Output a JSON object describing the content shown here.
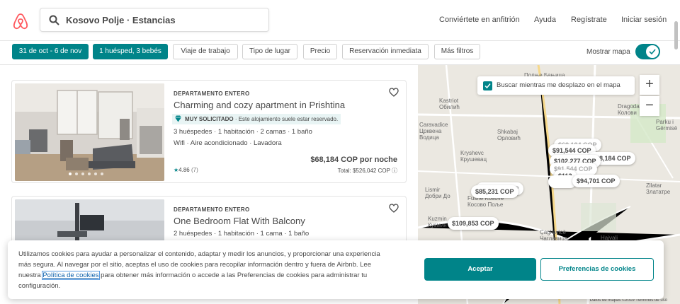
{
  "search": {
    "query": "Kosovo Polje · Estancias"
  },
  "nav": {
    "host": "Conviértete en anfitrión",
    "help": "Ayuda",
    "signup": "Regístrate",
    "login": "Iniciar sesión"
  },
  "filters": {
    "dates": "31 de oct - 6 de nov",
    "guests": "1 huésped, 3 bebés",
    "work_trip": "Viaje de trabajo",
    "place_type": "Tipo de lugar",
    "price": "Precio",
    "instant_book": "Reservación inmediata",
    "more": "Más filtros",
    "show_map": "Mostrar mapa"
  },
  "listings": [
    {
      "type": "DEPARTAMENTO ENTERO",
      "title": "Charming and cozy apartment in Prishtina",
      "badge_strong": "MUY SOLICITADO",
      "badge_text": " · Este alojamiento suele estar reservado.",
      "details": "3 huéspedes · 1 habitación · 2 camas · 1 baño",
      "amenities": "Wifi · Aire acondicionado · Lavadora",
      "price": "$68,184 COP por noche",
      "total": "Total: $526,042 COP ⓘ",
      "rating_star": "★",
      "rating": "4.86",
      "reviews": "(7)"
    },
    {
      "type": "DEPARTAMENTO ENTERO",
      "title": "One Bedroom Flat With Balcony",
      "details": "2 huéspedes · 1 habitación · 1 cama · 1 baño"
    }
  ],
  "map": {
    "search_as_move": "Buscar mientras me desplazo en el mapa",
    "zoom_in": "+",
    "zoom_out": "−",
    "prices": {
      "p1": "$91,544 COP",
      "p2": "$102,277 COP",
      "p3": "$68,184 COP",
      "p4": "$113",
      "p5": "$94,701 COP",
      "p6": "$85,231 COP",
      "p7": "$109,853 COP"
    },
    "towns": {
      "t1": "Kastriot\nОбилић",
      "t2": "Caravadice\nЦрквена\nВодица",
      "t3": "Shkabaj\nОрловић",
      "t4": "Kryshevc\nКрушевац",
      "t5": "Lismir\nДобри До",
      "t6": "Fushë Kosovë\nКосово Поље",
      "t7": "Kuzmin\nКузмин",
      "t8": "Çagllavicë\nЧаглавица",
      "t9": "Dragodan\nКолови",
      "t10": "Zllatar\nЗлататре",
      "t11": "Parku i\nGërmisë",
      "t12": "Hajvali",
      "t13": "Полње Бањица"
    },
    "credit": "Datos de mapas ©2019    Términos de uso"
  },
  "cookie": {
    "text_before": "Utilizamos cookies para ayudar a personalizar el contenido, adaptar y medir los anuncios, y proporcionar una experiencia más segura. Al navegar por el sitio, aceptas el uso de cookies para recopilar información dentro y fuera de Airbnb. Lee nuestra ",
    "link": "Política de cookies",
    "text_after": " para obtener más información o accede a las Preferencias de cookies para administrar tu configuración.",
    "accept": "Aceptar",
    "preferences": "Preferencias de cookies"
  },
  "colors": {
    "brand": "#FF5A5F",
    "accent": "#008489",
    "text": "#484848"
  }
}
